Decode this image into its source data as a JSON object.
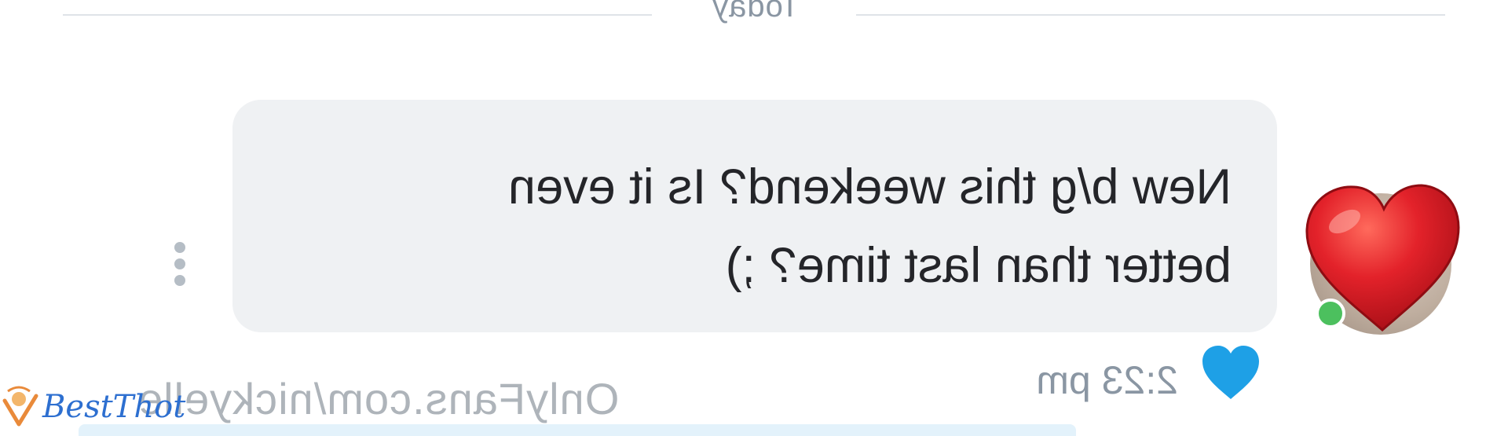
{
  "chat": {
    "day_separator": "Today",
    "message": {
      "text": "New b/g this weekend? Is it even\nbetter than last time? ;)",
      "time": "2:23 pm",
      "liked": true
    },
    "sender": {
      "online": true,
      "sticker": "red-heart-emoji"
    }
  },
  "overlay": {
    "watermark": "OnlyFans.com/nickyelle",
    "logo_text": "BestThot"
  },
  "colors": {
    "bubble_bg": "#eff1f3",
    "text": "#242529",
    "muted": "#8a96a3",
    "like_heart": "#1ea0e6",
    "sticker_heart": "#e01b24",
    "online": "#4cc05e",
    "logo": "#2d6fd0"
  },
  "icons": [
    "more-vertical-icon",
    "like-heart-icon",
    "red-heart-sticker-icon",
    "bestthot-logo-icon"
  ],
  "mirrored": true
}
